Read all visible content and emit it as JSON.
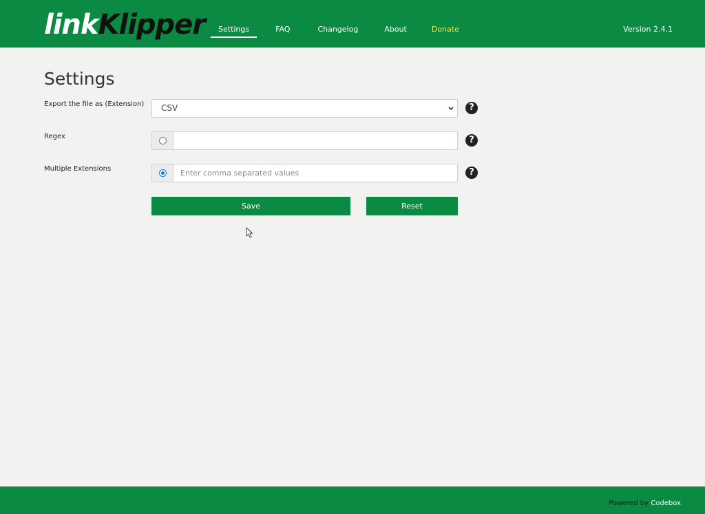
{
  "header": {
    "logo_part1": "link",
    "logo_part2": "Klipper",
    "nav": {
      "settings": "Settings",
      "faq": "FAQ",
      "changelog": "Changelog",
      "about": "About",
      "donate": "Donate"
    },
    "version": "Version 2.4.1"
  },
  "main": {
    "title": "Settings",
    "export": {
      "label": "Export the file as (Extension)",
      "selected": "CSV"
    },
    "regex": {
      "label": "Regex",
      "value": "",
      "checked": false
    },
    "multiple": {
      "label": "Multiple Extensions",
      "placeholder": "Enter comma separated values",
      "checked": true
    },
    "help_glyph": "?",
    "save_label": "Save",
    "reset_label": "Reset"
  },
  "footer": {
    "powered_by": "Powered by",
    "brand": "Codebox"
  },
  "icons": {
    "help": "question-circle-icon",
    "chevron": "chevron-down-icon",
    "cursor": "mouse-pointer-icon"
  },
  "colors": {
    "brand_green": "#0a8a42",
    "donate_yellow": "#f5e94a",
    "background": "#f2f2f0"
  }
}
